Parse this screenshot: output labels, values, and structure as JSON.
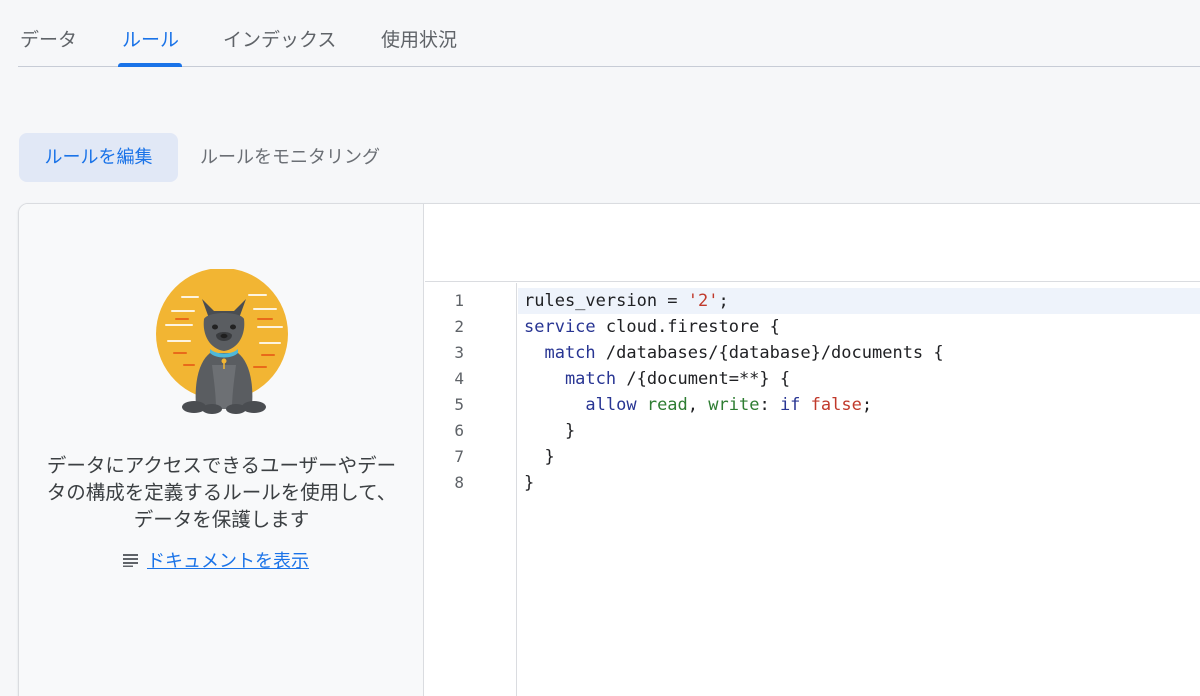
{
  "tabs": [
    {
      "label": "データ"
    },
    {
      "label": "ルール"
    },
    {
      "label": "インデックス"
    },
    {
      "label": "使用状況"
    }
  ],
  "subtabs": {
    "edit": "ルールを編集",
    "monitor": "ルールをモニタリング"
  },
  "left_panel": {
    "description": "データにアクセスできるユーザーやデータの構成を定義するルールを使用して、データを保護します",
    "doc_link": "ドキュメントを表示"
  },
  "editor": {
    "line_numbers": [
      "1",
      "2",
      "3",
      "4",
      "5",
      "6",
      "7",
      "8"
    ],
    "lines": {
      "l1_a": "rules_version = ",
      "l1_b": "'2'",
      "l1_c": ";",
      "l2_a": "service",
      "l2_b": " cloud.firestore {",
      "l3_a": "  match",
      "l3_b": " /databases/{database}/documents {",
      "l4_a": "    match",
      "l4_b": " /{document=**} {",
      "l5_a": "      allow",
      "l5_b": " read",
      "l5_c": ", ",
      "l5_d": "write",
      "l5_e": ": ",
      "l5_f": "if",
      "l5_g": " false",
      "l5_h": ";",
      "l6": "    }",
      "l7": "  }",
      "l8": "}"
    }
  },
  "colors": {
    "accent": "#1a73e8",
    "keyword": "#283593",
    "string": "#c0392b",
    "identifier": "#2e7d32"
  }
}
